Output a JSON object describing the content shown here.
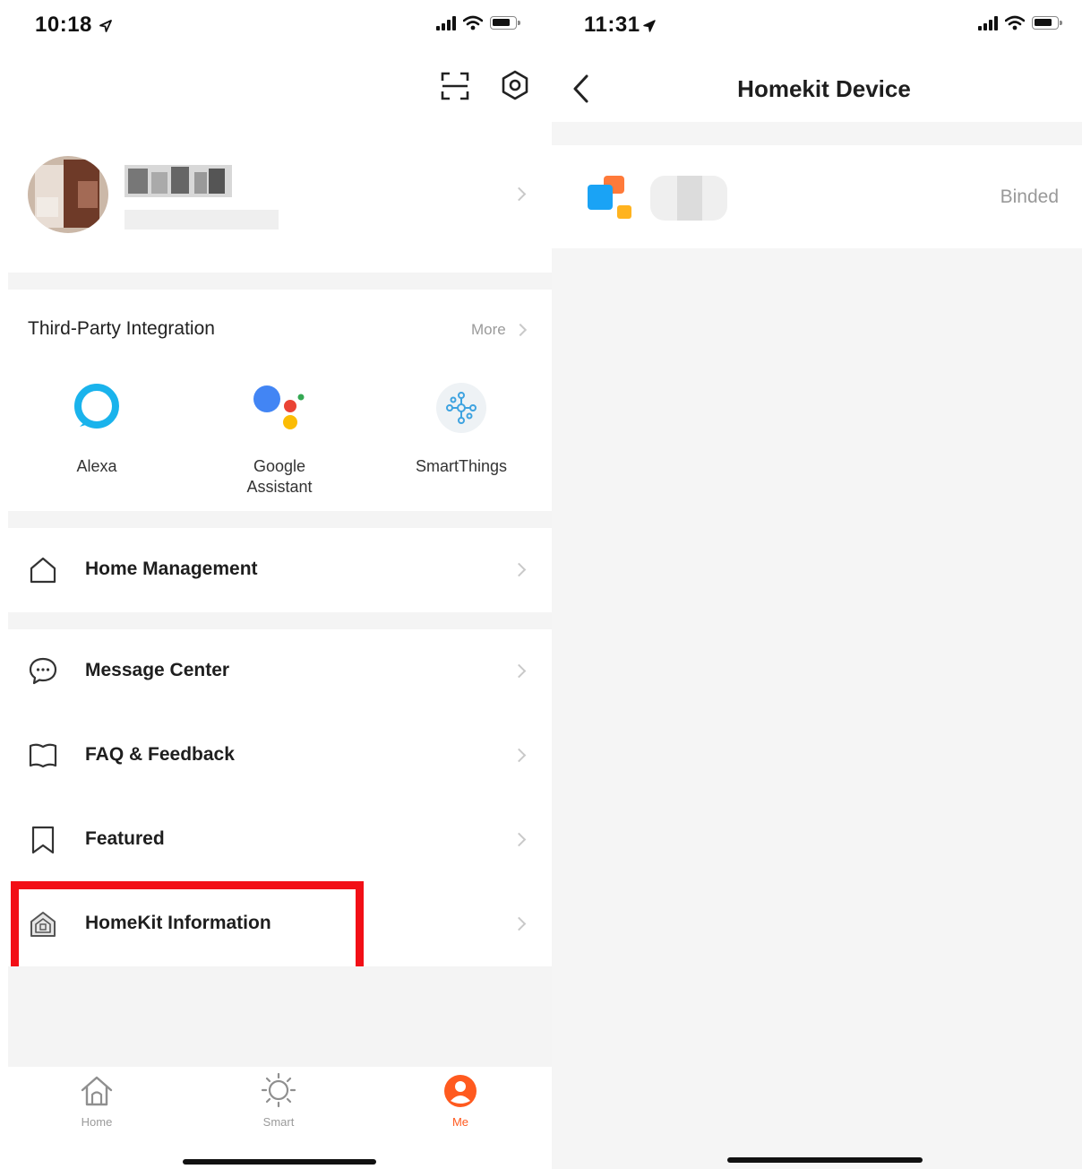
{
  "left_screen": {
    "status_bar": {
      "time": "10:18"
    },
    "profile": {
      "avatar": "blurred-avatar",
      "name": "",
      "subtitle": ""
    },
    "third_party": {
      "title": "Third-Party Integration",
      "more_label": "More",
      "items": [
        {
          "label": "Alexa",
          "icon": "alexa-icon"
        },
        {
          "label_line1": "Google",
          "label_line2": "Assistant",
          "icon": "google-assistant-icon"
        },
        {
          "label": "SmartThings",
          "icon": "smartthings-icon"
        }
      ]
    },
    "menu": {
      "home_management": "Home Management",
      "message_center": "Message Center",
      "faq_feedback": "FAQ & Feedback",
      "featured": "Featured",
      "homekit_information": "HomeKit Information"
    },
    "tab_bar": [
      {
        "label": "Home",
        "icon": "home-icon",
        "active": false
      },
      {
        "label": "Smart",
        "icon": "sun-icon",
        "active": false
      },
      {
        "label": "Me",
        "icon": "person-icon",
        "active": true
      }
    ]
  },
  "right_screen": {
    "status_bar": {
      "time": "11:31"
    },
    "header": {
      "title": "Homekit Device"
    },
    "device": {
      "name": "",
      "status": "Binded"
    }
  },
  "colors": {
    "accent": "#ff5a1f",
    "highlight_box": "#f20f16",
    "alexa": "#1ab3ec",
    "google_blue": "#4285f4",
    "google_red": "#ea4335",
    "google_yellow": "#fbbc05",
    "google_green": "#34a853",
    "device_blue": "#1aa3f5",
    "device_orange": "#ff7a3a",
    "device_yellow": "#ffb31f"
  }
}
